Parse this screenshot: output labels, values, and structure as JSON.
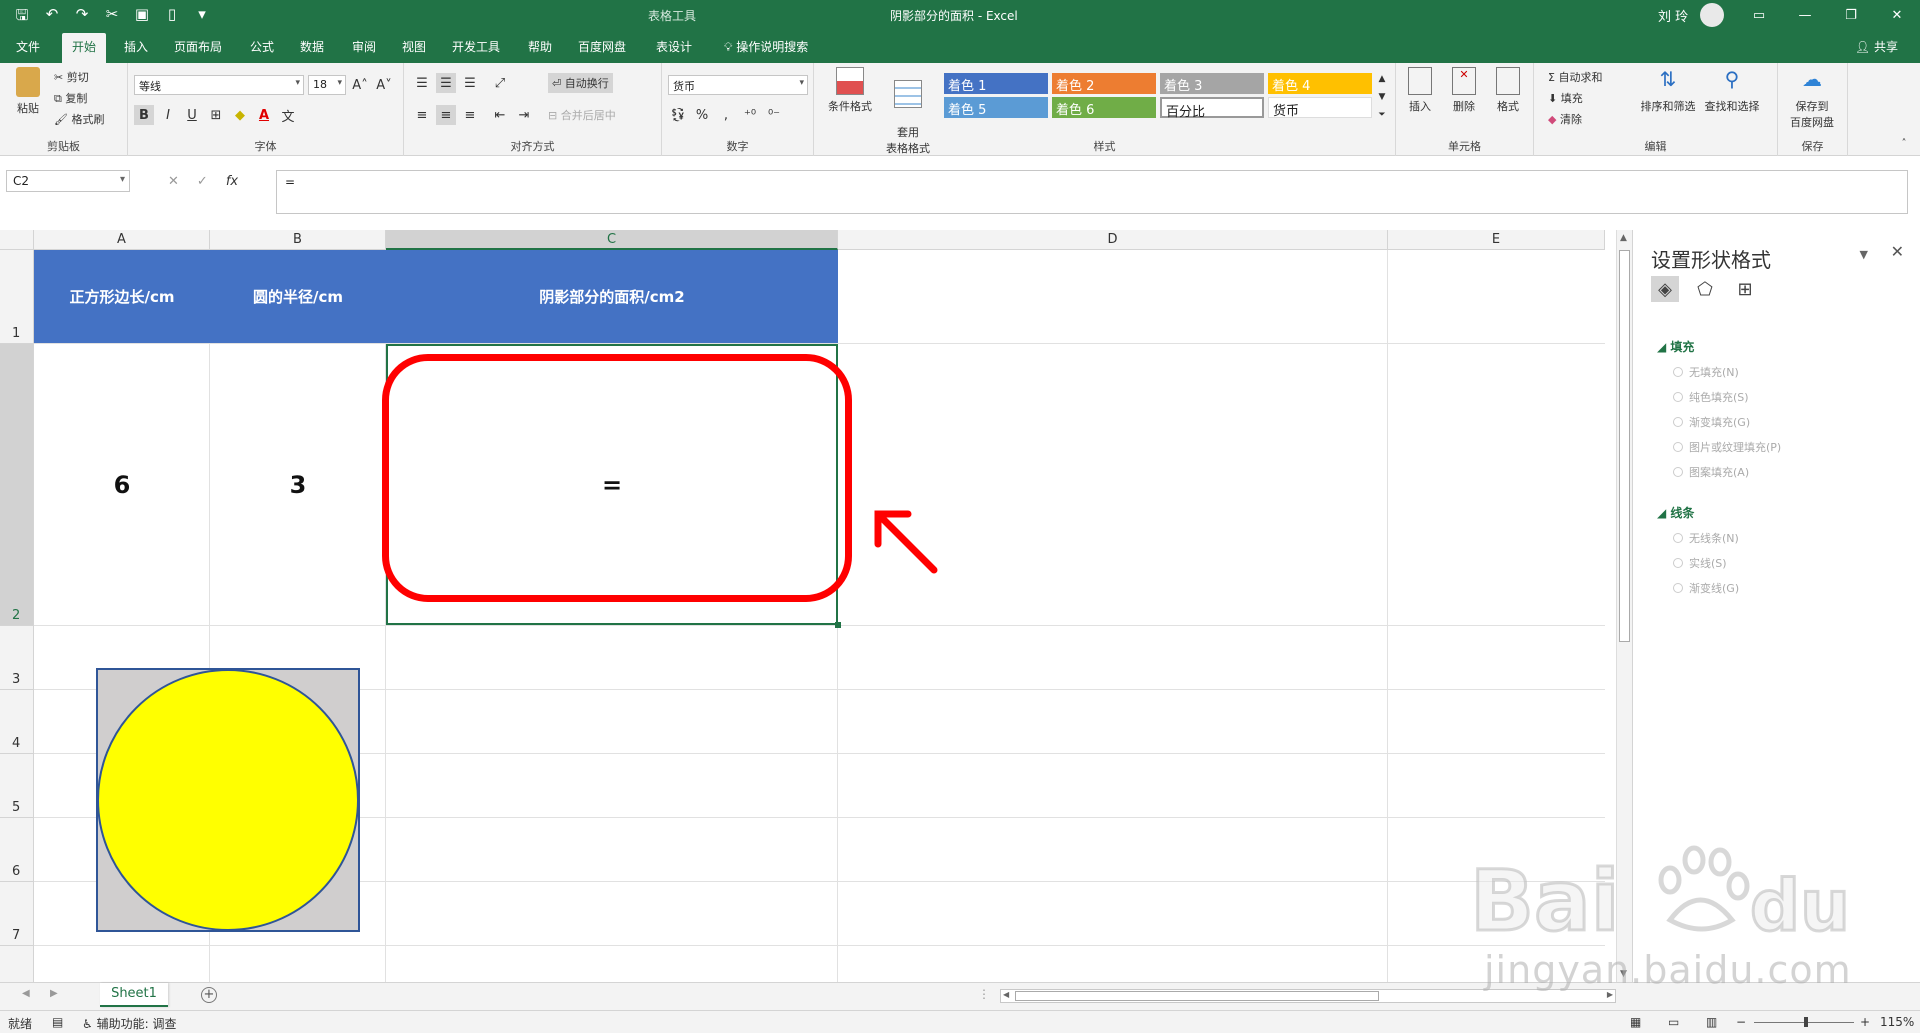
{
  "window": {
    "title": "阴影部分的面积  -  Excel",
    "context_tab_label": "表格工具",
    "user_name": "刘 玲"
  },
  "ribbon_tabs": [
    "文件",
    "开始",
    "插入",
    "页面布局",
    "公式",
    "数据",
    "审阅",
    "视图",
    "开发工具",
    "帮助",
    "百度网盘",
    "表设计"
  ],
  "active_tab": "开始",
  "tell_me": "操作说明搜索",
  "share": "共享",
  "ribbon": {
    "clipboard": {
      "paste": "粘贴",
      "cut": "剪切",
      "copy": "复制",
      "format_painter": "格式刷",
      "label": "剪贴板"
    },
    "font": {
      "name": "等线",
      "size": "18",
      "bold": "B",
      "italic": "I",
      "underline": "U",
      "label": "字体"
    },
    "alignment": {
      "wrap": "自动换行",
      "merge": "合并后居中",
      "label": "对齐方式"
    },
    "number": {
      "format": "货币",
      "label": "数字"
    },
    "styles": {
      "conditional": "条件格式",
      "table_format": "套用\n表格格式",
      "cells": [
        "着色 1",
        "着色 2",
        "着色 3",
        "着色 4",
        "着色 5",
        "着色 6",
        "百分比",
        "货币"
      ],
      "cell_colors": [
        "#4472c4",
        "#ed7d31",
        "#a5a5a5",
        "#ffc000",
        "#5b9bd5",
        "#70ad47",
        "#ffffff",
        "#ffffff"
      ],
      "label": "样式"
    },
    "cells_group": {
      "insert": "插入",
      "delete": "删除",
      "format": "格式",
      "label": "单元格"
    },
    "editing": {
      "autosum": "自动求和",
      "fill": "填充",
      "clear": "清除",
      "sort_filter": "排序和筛选",
      "find_select": "查找和选择",
      "label": "编辑"
    },
    "save": {
      "save_to": "保存到\n百度网盘",
      "label": "保存"
    }
  },
  "formula_bar": {
    "name_box": "C2",
    "formula": "="
  },
  "columns": [
    "A",
    "B",
    "C",
    "D",
    "E"
  ],
  "rows": [
    "1",
    "2",
    "3",
    "4",
    "5",
    "6",
    "7"
  ],
  "table": {
    "headers": [
      "正方形边长/cm",
      "圆的半径/cm",
      "阴影部分的面积/cm2"
    ],
    "values": [
      "6",
      "3",
      "="
    ]
  },
  "sheet_tab": "Sheet1",
  "status": {
    "ready": "就绪",
    "accessibility": "辅助功能: 调查",
    "zoom": "115%"
  },
  "format_pane": {
    "title": "设置形状格式",
    "fill_section": "填充",
    "fill_options": [
      "无填充(N)",
      "纯色填充(S)",
      "渐变填充(G)",
      "图片或纹理填充(P)",
      "图案填充(A)"
    ],
    "line_section": "线条",
    "line_options": [
      "无线条(N)",
      "实线(S)",
      "渐变线(G)"
    ]
  },
  "watermark": "jingyan.baidu.com",
  "shape_colors": {
    "square": "#d0cece",
    "circle": "#ffff00",
    "outline": "#2f5597"
  },
  "highlight_color": "#ff0000"
}
